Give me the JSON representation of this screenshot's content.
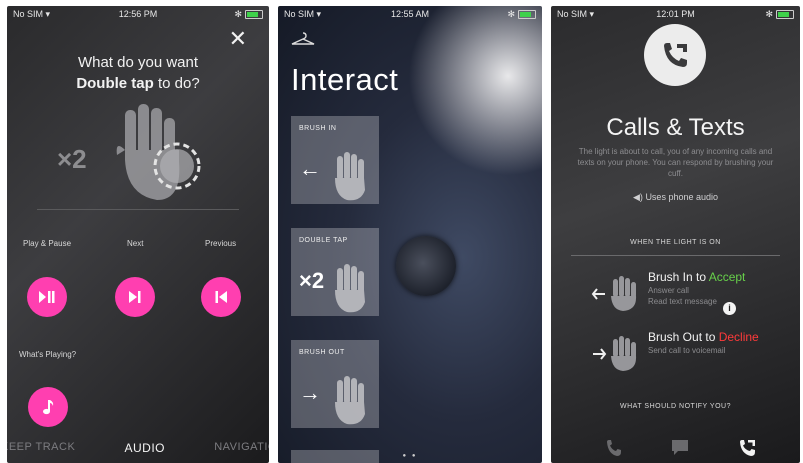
{
  "phone1": {
    "status": {
      "carrier": "No SIM ▾",
      "time": "12:56 PM",
      "battery": "✻"
    },
    "close_icon": "✕",
    "title_line1": "What do you want",
    "title_line2_bold": "Double tap",
    "title_line2_rest": " to do?",
    "gesture_count": "×2",
    "labels": {
      "play_pause": "Play & Pause",
      "next": "Next",
      "previous": "Previous",
      "whats_playing": "What's Playing?"
    },
    "tabs": [
      {
        "label": "KEEP TRACK"
      },
      {
        "label": "AUDIO"
      },
      {
        "label": "NAVIGATIO"
      }
    ],
    "accent": "#ff3fb0"
  },
  "phone2": {
    "status": {
      "carrier": "No SIM ▾",
      "time": "12:55 AM",
      "battery": "✻"
    },
    "heading": "Interact",
    "cards": [
      {
        "title": "BRUSH IN",
        "symbol": "←"
      },
      {
        "title": "DOUBLE TAP",
        "symbol": "×2"
      },
      {
        "title": "BRUSH OUT",
        "symbol": "→"
      }
    ]
  },
  "phone3": {
    "status": {
      "carrier": "No SIM ▾",
      "time": "12:01 PM",
      "battery": "✻"
    },
    "heading": "Calls & Texts",
    "description": "The light is about to call, you of any incoming calls and texts on your phone. You can respond by brushing your cuff.",
    "audio_option": "Uses phone audio",
    "section_light": "WHEN THE LIGHT IS ON",
    "rows": [
      {
        "prefix": "Brush In to ",
        "action": "Accept",
        "sub1": "Answer call",
        "sub2": "Read text message"
      },
      {
        "prefix": "Brush Out to ",
        "action": "Decline",
        "sub1": "Send call to voicemail",
        "sub2": ""
      }
    ],
    "info_icon": "i",
    "section_notify": "WHAT SHOULD NOTIFY YOU?",
    "colors": {
      "accept": "#67d14a",
      "decline": "#ff3a3a"
    }
  }
}
